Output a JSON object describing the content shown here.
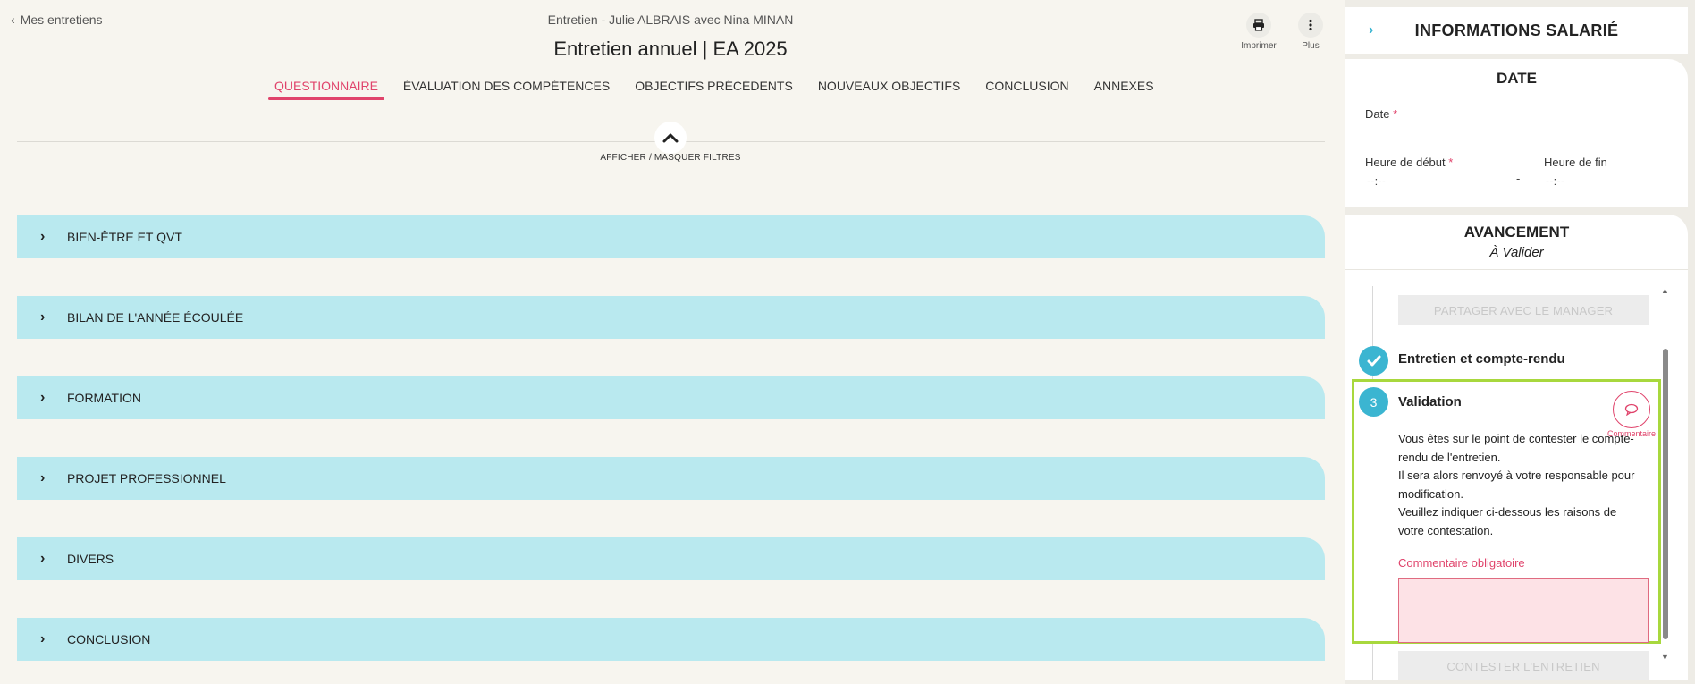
{
  "header": {
    "back_label": "Mes entretiens",
    "subtitle": "Entretien - Julie ALBRAIS avec Nina MINAN",
    "title": "Entretien annuel | EA 2025",
    "actions": [
      {
        "label": "Imprimer",
        "icon": "printer-icon"
      },
      {
        "label": "Plus",
        "icon": "more-vertical-icon"
      }
    ]
  },
  "tabs": [
    {
      "label": "QUESTIONNAIRE",
      "active": true
    },
    {
      "label": "ÉVALUATION DES COMPÉTENCES",
      "active": false
    },
    {
      "label": "OBJECTIFS PRÉCÉDENTS",
      "active": false
    },
    {
      "label": "NOUVEAUX OBJECTIFS",
      "active": false
    },
    {
      "label": "CONCLUSION",
      "active": false
    },
    {
      "label": "ANNEXES",
      "active": false
    }
  ],
  "filters": {
    "toggle_label": "AFFICHER / MASQUER FILTRES"
  },
  "sections": [
    {
      "label": "BIEN-ÊTRE ET QVT"
    },
    {
      "label": "BILAN DE L'ANNÉE ÉCOULÉE"
    },
    {
      "label": "FORMATION"
    },
    {
      "label": "PROJET PROFESSIONNEL"
    },
    {
      "label": "DIVERS"
    },
    {
      "label": "CONCLUSION"
    }
  ],
  "panel": {
    "title": "INFORMATIONS SALARIÉ",
    "date_card": {
      "title": "DATE",
      "date_label": "Date",
      "start_label": "Heure de début",
      "end_label": "Heure de fin",
      "start_value": "--:--",
      "separator": "-",
      "end_value": "--:--",
      "required_mark": "*"
    },
    "progress_card": {
      "title": "AVANCEMENT",
      "status": "À Valider",
      "share_button": "PARTAGER AVEC LE MANAGER",
      "step_done_title": "Entretien et compte-rendu",
      "step_current_number": "3",
      "step_current_title": "Validation",
      "validation_text_1": "Vous êtes sur le point de contester le compte-rendu de l'entretien.",
      "validation_text_2": "Il sera alors renvoyé à votre responsable pour modification.",
      "validation_text_3": "Veuillez indiquer ci-dessous les raisons de votre contestation.",
      "comment_label": "Commentaire",
      "mandatory_label": "Commentaire obligatoire",
      "contest_button": "CONTESTER L'ENTRETIEN"
    }
  },
  "colors": {
    "accent": "#e0436b",
    "teal": "#3bb5d1",
    "section_bg": "#b9e9ef",
    "highlight": "#a8d83d"
  }
}
